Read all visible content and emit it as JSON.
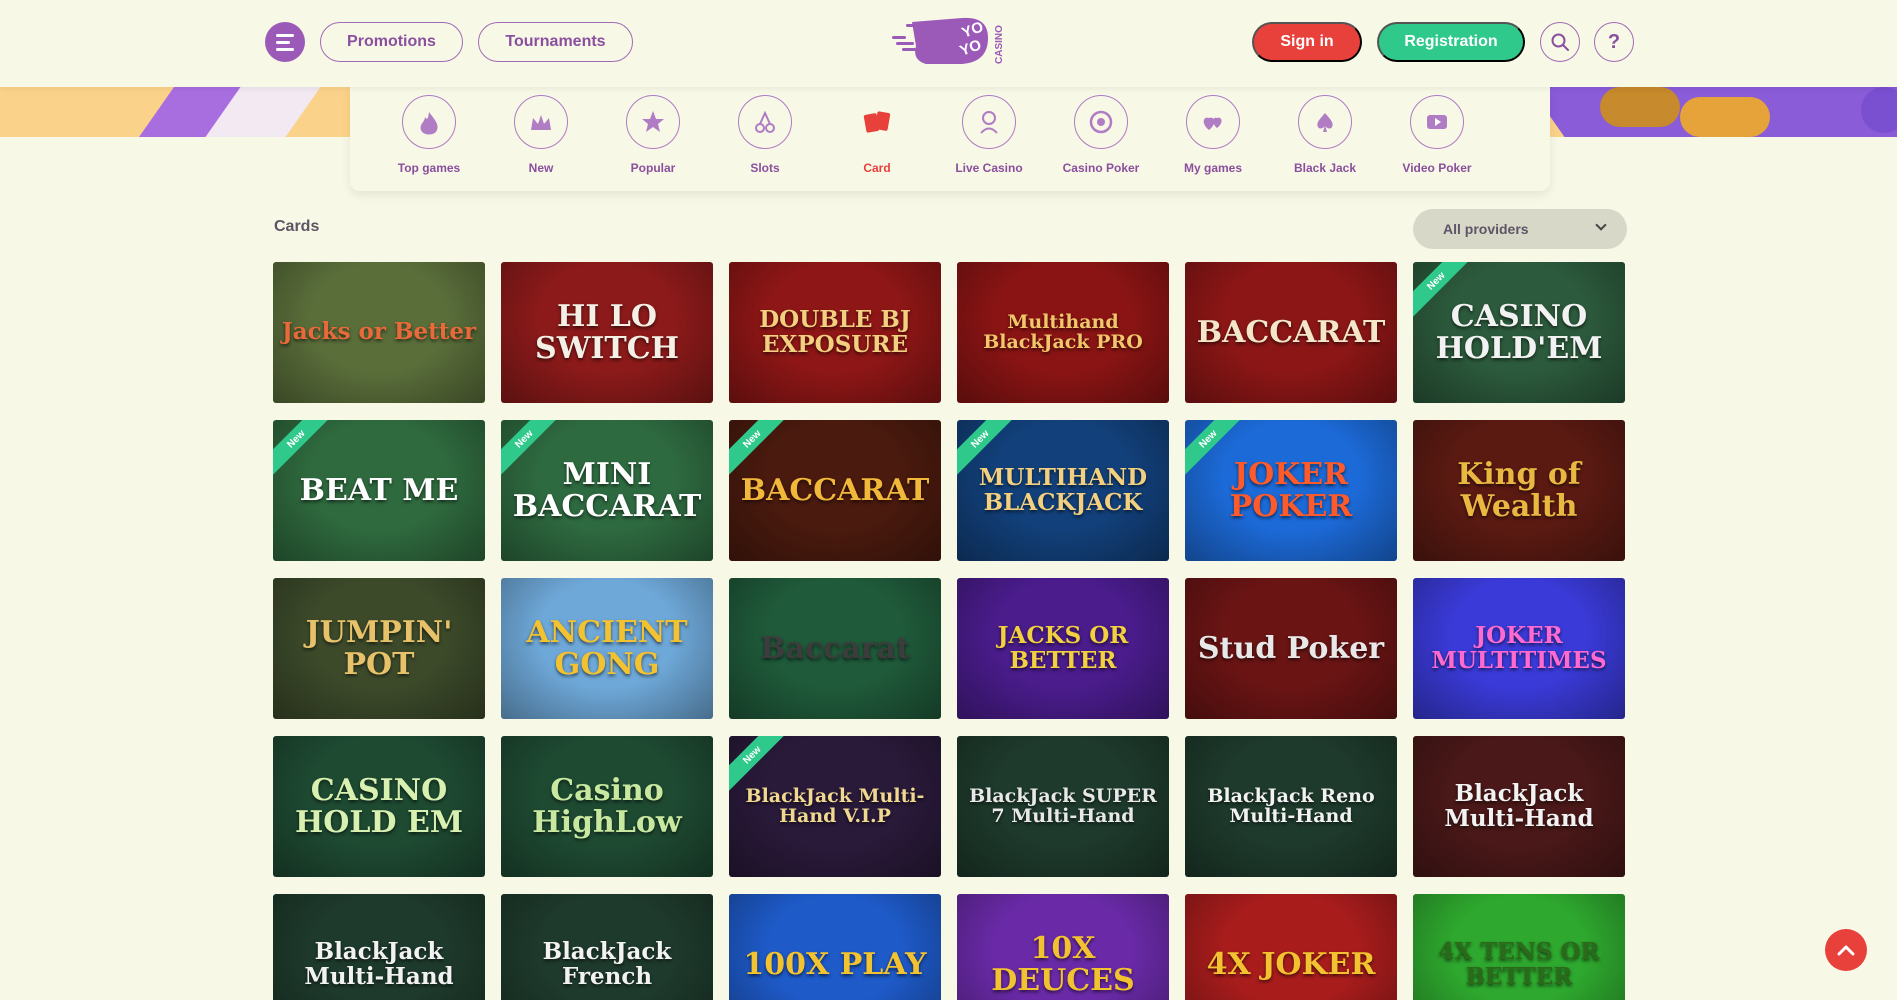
{
  "header": {
    "promotions_label": "Promotions",
    "tournaments_label": "Tournaments",
    "signin_label": "Sign in",
    "registration_label": "Registration",
    "help_label": "?",
    "logo_text_top": "YO",
    "logo_text_bottom": "YO",
    "logo_text_side": "CASINO"
  },
  "categories": [
    {
      "label": "Top games",
      "icon": "flame-icon"
    },
    {
      "label": "New",
      "icon": "crown-icon"
    },
    {
      "label": "Popular",
      "icon": "star-icon"
    },
    {
      "label": "Slots",
      "icon": "cherry-icon"
    },
    {
      "label": "Card",
      "icon": "cards-icon",
      "active": true
    },
    {
      "label": "Live Casino",
      "icon": "dealer-icon"
    },
    {
      "label": "Casino Poker",
      "icon": "poker-chip-icon"
    },
    {
      "label": "My games",
      "icon": "hearts-icon"
    },
    {
      "label": "Black Jack",
      "icon": "spade-icon"
    },
    {
      "label": "Video Poker",
      "icon": "play-icon"
    }
  ],
  "section": {
    "title": "Cards",
    "provider_filter": "All providers"
  },
  "badge_label": "New",
  "games": [
    {
      "title": "Jacks or Better",
      "bg": "#5a6e3a",
      "color": "#e86a3a",
      "new": false
    },
    {
      "title": "HI LO SWITCH",
      "bg": "#8c1a1a",
      "color": "#f4f0e6",
      "new": false
    },
    {
      "title": "DOUBLE BJ EXPOSURE",
      "bg": "#8e1616",
      "color": "#f2d080",
      "new": false
    },
    {
      "title": "Multihand BlackJack PRO",
      "bg": "#8a1414",
      "color": "#f2c66a",
      "new": false
    },
    {
      "title": "BACCARAT",
      "bg": "#8c1616",
      "color": "#f4e6c8",
      "new": false
    },
    {
      "title": "CASINO HOLD'EM",
      "bg": "#2c5a3c",
      "color": "#f2f2f2",
      "new": true
    },
    {
      "title": "BEAT ME",
      "bg": "#2f6a3e",
      "color": "#ffffff",
      "new": true
    },
    {
      "title": "MINI BACCARAT",
      "bg": "#2e6a40",
      "color": "#ffffff",
      "new": true
    },
    {
      "title": "BACCARAT",
      "bg": "#4a1a0e",
      "color": "#f2b83a",
      "new": true
    },
    {
      "title": "MULTIHAND BLACKJACK",
      "bg": "#12407a",
      "color": "#f2d080",
      "new": true
    },
    {
      "title": "JOKER POKER",
      "bg": "#1c6ad8",
      "color": "#ff5a2a",
      "new": true
    },
    {
      "title": "King of Wealth",
      "bg": "#5a1a12",
      "color": "#e8b840",
      "new": false
    },
    {
      "title": "JUMPIN' POT",
      "bg": "#3c4a2a",
      "color": "#e8c26a",
      "new": false
    },
    {
      "title": "ANCIENT GONG",
      "bg": "#6ea8d8",
      "color": "#f2c230",
      "new": false
    },
    {
      "title": "Baccarat",
      "bg": "#1f5a3a",
      "color": "#3c3c3c",
      "new": false
    },
    {
      "title": "JACKS OR BETTER",
      "bg": "#4a1c8c",
      "color": "#f2d040",
      "new": false
    },
    {
      "title": "Stud Poker",
      "bg": "#6a1414",
      "color": "#e8e8e8",
      "new": false
    },
    {
      "title": "JOKER MULTITIMES",
      "bg": "#3a3ad8",
      "color": "#ff6ad0",
      "new": false
    },
    {
      "title": "CASINO HOLD EM",
      "bg": "#1e4a32",
      "color": "#d8f0b0",
      "new": false
    },
    {
      "title": "Casino HighLow",
      "bg": "#1e4a32",
      "color": "#c8e8a0",
      "new": false
    },
    {
      "title": "BlackJack Multi-Hand V.I.P",
      "bg": "#2a1a3a",
      "color": "#f0d890",
      "new": true
    },
    {
      "title": "BlackJack SUPER 7 Multi-Hand",
      "bg": "#1e3a2c",
      "color": "#e8e8e8",
      "new": false
    },
    {
      "title": "BlackJack Reno Multi-Hand",
      "bg": "#1e3a2c",
      "color": "#f2f2f2",
      "new": false
    },
    {
      "title": "BlackJack Multi-Hand",
      "bg": "#4a1818",
      "color": "#f2f2f2",
      "new": false
    },
    {
      "title": "BlackJack Multi-Hand",
      "bg": "#1e3a2c",
      "color": "#f2f2f2",
      "new": false
    },
    {
      "title": "BlackJack French",
      "bg": "#1e3a2c",
      "color": "#f2f2f2",
      "new": false
    },
    {
      "title": "100X PLAY",
      "bg": "#1e5ac8",
      "color": "#f2c230",
      "new": false
    },
    {
      "title": "10X DEUCES",
      "bg": "#6a2aa8",
      "color": "#f2c230",
      "new": false
    },
    {
      "title": "4X JOKER",
      "bg": "#a81c1c",
      "color": "#f2c230",
      "new": false
    },
    {
      "title": "4X TENS OR BETTER",
      "bg": "#2ea82e",
      "color": "#2a6a1a",
      "new": false
    }
  ],
  "colors": {
    "background": "#f8f8e6",
    "purple": "#9b5ab8",
    "signin_red": "#e8403b",
    "registration_green": "#2ec98b"
  }
}
